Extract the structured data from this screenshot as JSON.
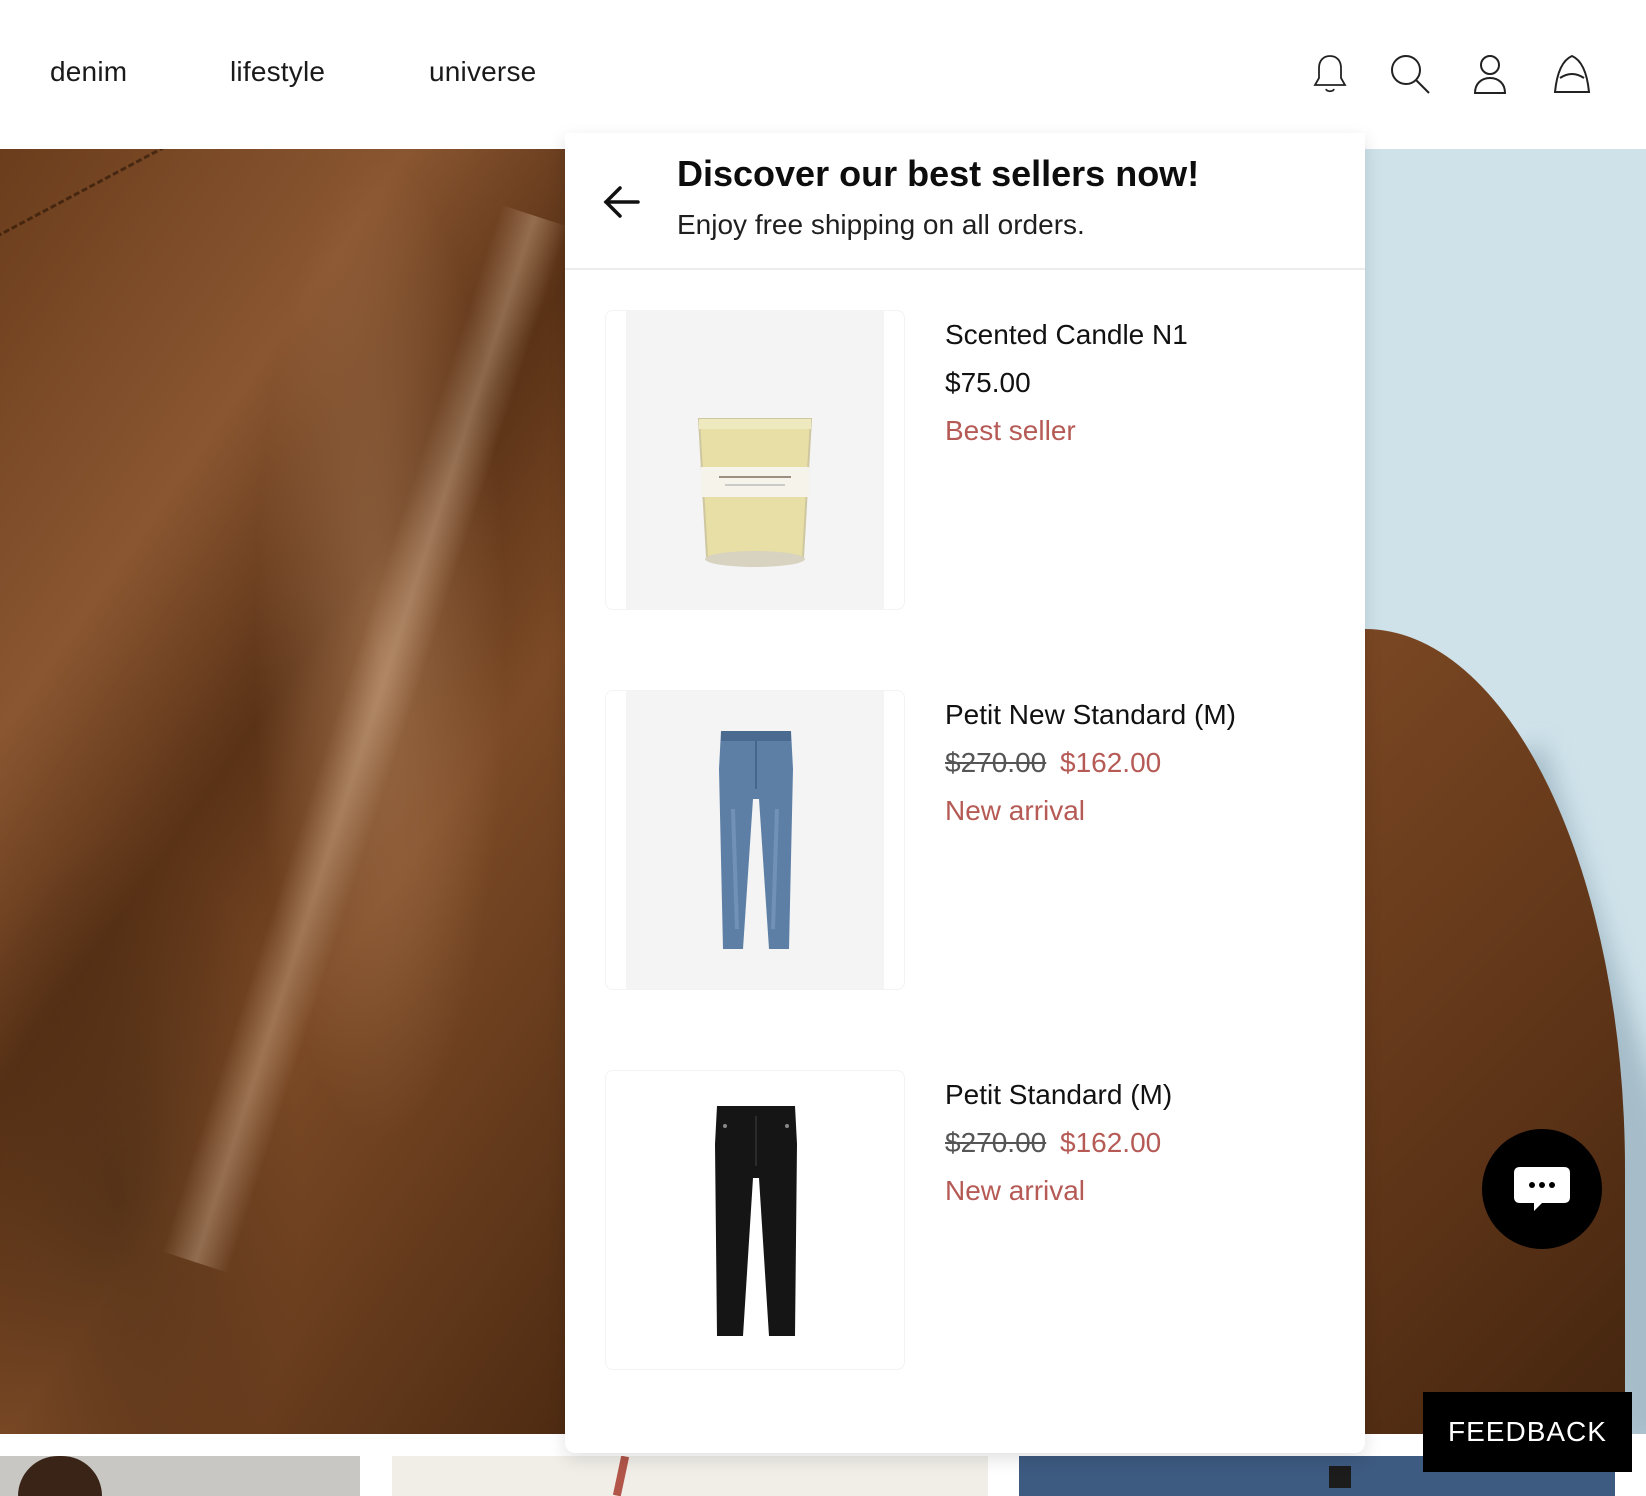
{
  "nav": {
    "links": [
      {
        "label": "denim"
      },
      {
        "label": "lifestyle"
      },
      {
        "label": "universe"
      }
    ],
    "icons": [
      "bell-icon",
      "search-icon",
      "user-icon",
      "bag-icon"
    ]
  },
  "panel": {
    "title": "Discover our best sellers now!",
    "subtitle": "Enjoy free shipping on all orders.",
    "products": [
      {
        "name": "Scented Candle N1",
        "price": "$75.00",
        "original_price": "",
        "sale_price": "",
        "tag": "Best seller",
        "image": "candle"
      },
      {
        "name": "Petit New Standard (M)",
        "price": "",
        "original_price": "$270.00",
        "sale_price": "$162.00",
        "tag": "New arrival",
        "image": "blue-jeans"
      },
      {
        "name": "Petit Standard (M)",
        "price": "",
        "original_price": "$270.00",
        "sale_price": "$162.00",
        "tag": "New arrival",
        "image": "black-jeans"
      }
    ]
  },
  "feedback_label": "FEEDBACK",
  "colors": {
    "accent": "#b55a55",
    "panel_bg": "#ffffff",
    "button_bg": "#000000"
  }
}
